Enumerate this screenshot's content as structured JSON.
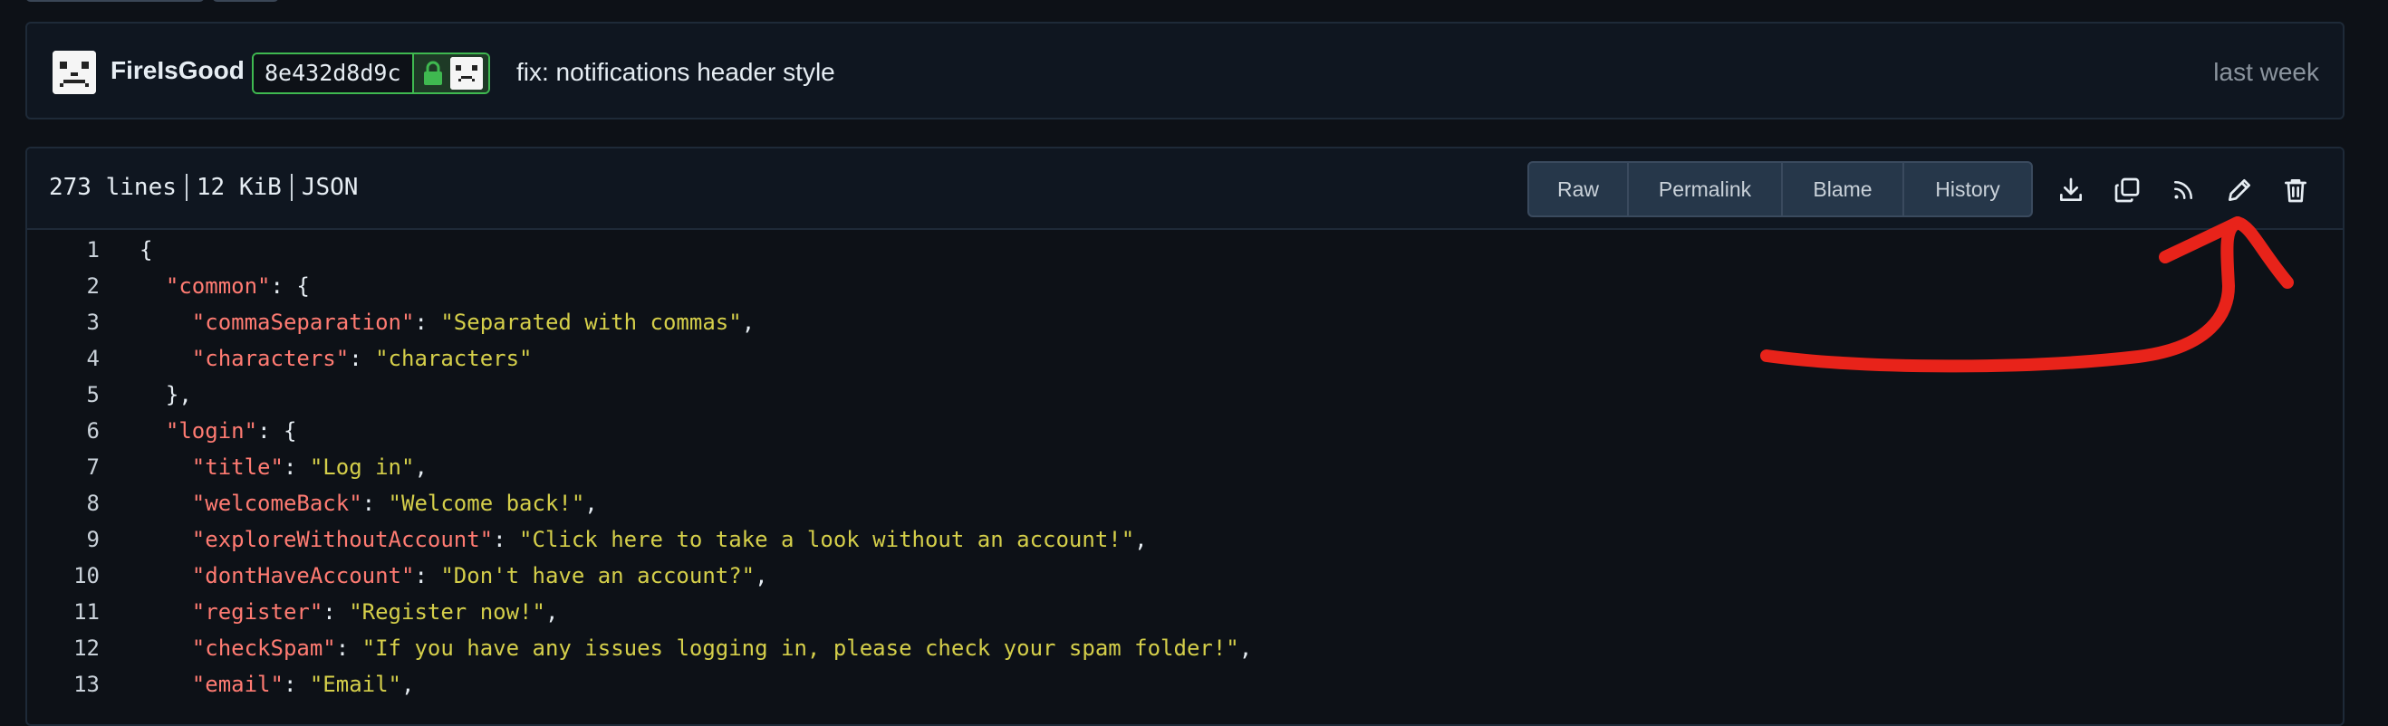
{
  "commit": {
    "author": "FireIsGood",
    "sha": "8e432d8d9c",
    "message": "fix: notifications header style",
    "time": "last week"
  },
  "file": {
    "lines": "273 lines",
    "size": "12 KiB",
    "type": "JSON"
  },
  "toolbar": {
    "raw": "Raw",
    "permalink": "Permalink",
    "blame": "Blame",
    "history": "History"
  },
  "icons": {
    "download": "download-icon",
    "copy": "copy-icon",
    "rss": "rss-icon",
    "edit": "pencil-icon",
    "delete": "trash-icon",
    "lock": "lock-icon"
  },
  "colors": {
    "background": "#0d1117",
    "key": "#ff7b72",
    "string": "#d5cf4a",
    "sign_border": "#3fb950",
    "annotation": "#e8231a"
  },
  "code_lines": [
    {
      "num": "1",
      "parts": [
        {
          "c": "p",
          "t": "{"
        }
      ]
    },
    {
      "num": "2",
      "parts": [
        {
          "c": "p",
          "t": "  "
        },
        {
          "c": "k",
          "t": "\"common\""
        },
        {
          "c": "p",
          "t": ": {"
        }
      ]
    },
    {
      "num": "3",
      "parts": [
        {
          "c": "p",
          "t": "    "
        },
        {
          "c": "k",
          "t": "\"commaSeparation\""
        },
        {
          "c": "p",
          "t": ": "
        },
        {
          "c": "s",
          "t": "\"Separated with commas\""
        },
        {
          "c": "p",
          "t": ","
        }
      ]
    },
    {
      "num": "4",
      "parts": [
        {
          "c": "p",
          "t": "    "
        },
        {
          "c": "k",
          "t": "\"characters\""
        },
        {
          "c": "p",
          "t": ": "
        },
        {
          "c": "s",
          "t": "\"characters\""
        }
      ]
    },
    {
      "num": "5",
      "parts": [
        {
          "c": "p",
          "t": "  },"
        }
      ]
    },
    {
      "num": "6",
      "parts": [
        {
          "c": "p",
          "t": "  "
        },
        {
          "c": "k",
          "t": "\"login\""
        },
        {
          "c": "p",
          "t": ": {"
        }
      ]
    },
    {
      "num": "7",
      "parts": [
        {
          "c": "p",
          "t": "    "
        },
        {
          "c": "k",
          "t": "\"title\""
        },
        {
          "c": "p",
          "t": ": "
        },
        {
          "c": "s",
          "t": "\"Log in\""
        },
        {
          "c": "p",
          "t": ","
        }
      ]
    },
    {
      "num": "8",
      "parts": [
        {
          "c": "p",
          "t": "    "
        },
        {
          "c": "k",
          "t": "\"welcomeBack\""
        },
        {
          "c": "p",
          "t": ": "
        },
        {
          "c": "s",
          "t": "\"Welcome back!\""
        },
        {
          "c": "p",
          "t": ","
        }
      ]
    },
    {
      "num": "9",
      "parts": [
        {
          "c": "p",
          "t": "    "
        },
        {
          "c": "k",
          "t": "\"exploreWithoutAccount\""
        },
        {
          "c": "p",
          "t": ": "
        },
        {
          "c": "s",
          "t": "\"Click here to take a look without an account!\""
        },
        {
          "c": "p",
          "t": ","
        }
      ]
    },
    {
      "num": "10",
      "parts": [
        {
          "c": "p",
          "t": "    "
        },
        {
          "c": "k",
          "t": "\"dontHaveAccount\""
        },
        {
          "c": "p",
          "t": ": "
        },
        {
          "c": "s",
          "t": "\"Don't have an account?\""
        },
        {
          "c": "p",
          "t": ","
        }
      ]
    },
    {
      "num": "11",
      "parts": [
        {
          "c": "p",
          "t": "    "
        },
        {
          "c": "k",
          "t": "\"register\""
        },
        {
          "c": "p",
          "t": ": "
        },
        {
          "c": "s",
          "t": "\"Register now!\""
        },
        {
          "c": "p",
          "t": ","
        }
      ]
    },
    {
      "num": "12",
      "parts": [
        {
          "c": "p",
          "t": "    "
        },
        {
          "c": "k",
          "t": "\"checkSpam\""
        },
        {
          "c": "p",
          "t": ": "
        },
        {
          "c": "s",
          "t": "\"If you have any issues logging in, please check your spam folder!\""
        },
        {
          "c": "p",
          "t": ","
        }
      ]
    },
    {
      "num": "13",
      "parts": [
        {
          "c": "p",
          "t": "    "
        },
        {
          "c": "k",
          "t": "\"email\""
        },
        {
          "c": "p",
          "t": ": "
        },
        {
          "c": "s",
          "t": "\"Email\""
        },
        {
          "c": "p",
          "t": ","
        }
      ]
    }
  ]
}
